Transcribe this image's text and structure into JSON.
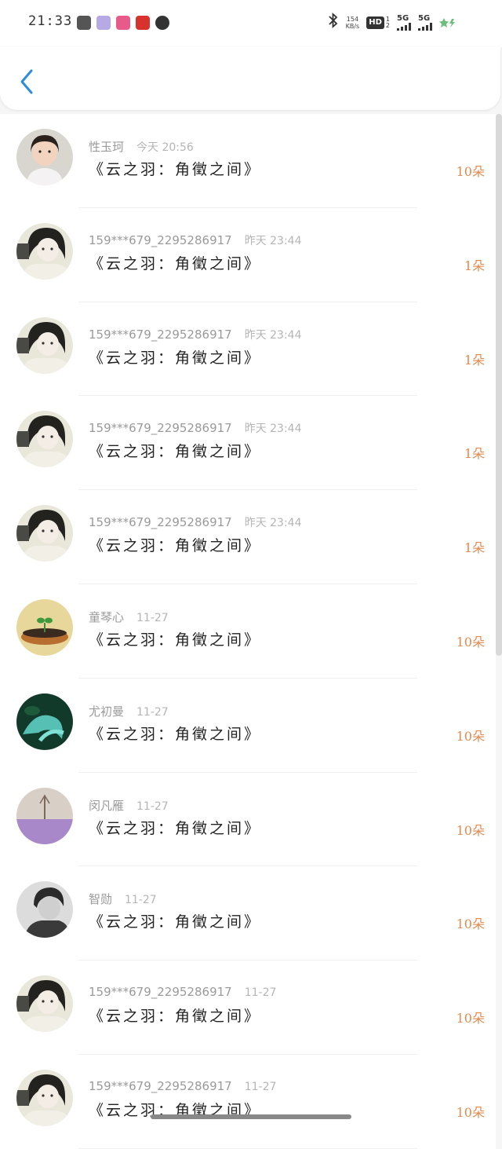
{
  "status_bar": {
    "time": "21:33",
    "net_speed_value": "154",
    "net_speed_unit": "KB/s",
    "hd_label": "HD",
    "hd_sub_top": "1",
    "hd_sub_bottom": "2",
    "signal_1": "5G",
    "signal_2": "5G",
    "icons": [
      "bluetooth-icon",
      "battery-charging-icon"
    ]
  },
  "header": {
    "back_icon": "chevron-left-icon"
  },
  "rows": [
    {
      "name": "性玉珂",
      "date": "今天 20:56",
      "title": "《云之羽：角徵之间》",
      "count": "10朵",
      "avatar": "child"
    },
    {
      "name": "159***679_2295286917",
      "date": "昨天 23:44",
      "title": "《云之羽：角徵之间》",
      "count": "1朵",
      "avatar": "woman"
    },
    {
      "name": "159***679_2295286917",
      "date": "昨天 23:44",
      "title": "《云之羽：角徵之间》",
      "count": "1朵",
      "avatar": "woman"
    },
    {
      "name": "159***679_2295286917",
      "date": "昨天 23:44",
      "title": "《云之羽：角徵之间》",
      "count": "1朵",
      "avatar": "woman"
    },
    {
      "name": "159***679_2295286917",
      "date": "昨天 23:44",
      "title": "《云之羽：角徵之间》",
      "count": "1朵",
      "avatar": "woman"
    },
    {
      "name": "童琴心",
      "date": "11-27",
      "title": "《云之羽：角徵之间》",
      "count": "10朵",
      "avatar": "sprout"
    },
    {
      "name": "尤初曼",
      "date": "11-27",
      "title": "《云之羽：角徵之间》",
      "count": "10朵",
      "avatar": "plant"
    },
    {
      "name": "闵凡雁",
      "date": "11-27",
      "title": "《云之羽：角徵之间》",
      "count": "10朵",
      "avatar": "purple"
    },
    {
      "name": "智勋",
      "date": "11-27",
      "title": "《云之羽：角徵之间》",
      "count": "10朵",
      "avatar": "bw"
    },
    {
      "name": "159***679_2295286917",
      "date": "11-27",
      "title": "《云之羽：角徵之间》",
      "count": "10朵",
      "avatar": "woman"
    },
    {
      "name": "159***679_2295286917",
      "date": "11-27",
      "title": "《云之羽：角徵之间》",
      "count": "10朵",
      "avatar": "woman"
    }
  ],
  "colors": {
    "accent": "#2b8ce0",
    "count": "#e28a4e",
    "name": "#9a9a9a"
  }
}
